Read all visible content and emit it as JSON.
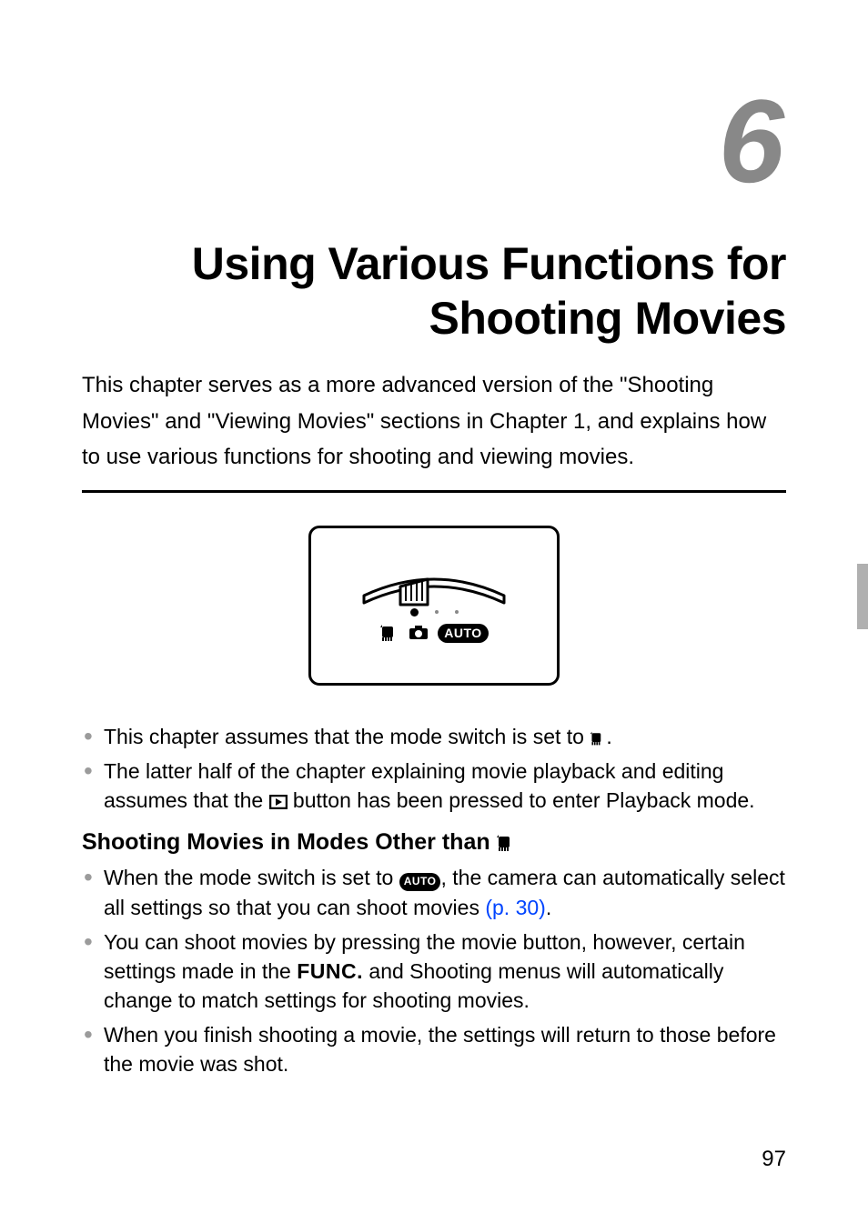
{
  "chapter": {
    "number": "6",
    "title": "Using Various Functions for\nShooting Movies",
    "intro": "This chapter serves as a more advanced version of the \"Shooting Movies\" and \"Viewing Movies\" sections in Chapter 1, and explains how to use various functions for shooting and viewing movies."
  },
  "bullets_top": [
    {
      "pre": "This chapter assumes that the mode switch is set to ",
      "icon": "movie-mode-icon",
      "post": "."
    },
    {
      "pre": "The latter half of the chapter explaining movie playback and editing assumes that the ",
      "icon": "playback-icon",
      "post": " button has been pressed to enter Playback mode."
    }
  ],
  "subheading": {
    "text": "Shooting Movies in Modes Other than ",
    "icon": "movie-mode-icon"
  },
  "bullets_bottom": [
    {
      "pre": "When the mode switch is set to ",
      "icon": "auto-pill-icon",
      "post1": ", the camera can automatically select all settings so that you can shoot movies ",
      "link": "(p. 30)",
      "post2": "."
    },
    {
      "pre": "You can shoot movies by pressing the movie button, however, certain settings made in the ",
      "icon": "func-text-icon",
      "func": "FUNC.",
      "post": " and Shooting menus will automatically change to match settings for shooting movies."
    },
    {
      "pre": "When you finish shooting a movie, the settings will return to those before the movie was shot."
    }
  ],
  "figure": {
    "modes": [
      "movie",
      "camera",
      "auto"
    ],
    "auto_label": "AUTO"
  },
  "page_number": "97"
}
